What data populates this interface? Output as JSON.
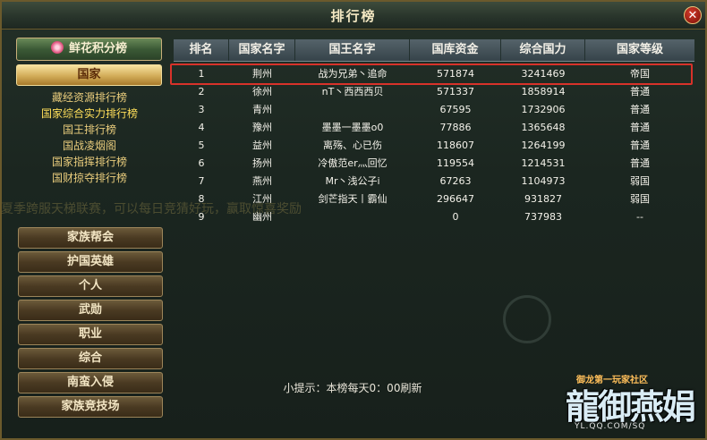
{
  "window": {
    "title": "排行榜",
    "close_glyph": "✕"
  },
  "sidebar": {
    "flower_header": "鲜花积分榜",
    "nation_button": "国家",
    "sub_items": [
      {
        "label": "藏经资源排行榜",
        "active": false
      },
      {
        "label": "国家综合实力排行榜",
        "active": true
      },
      {
        "label": "国王排行榜",
        "active": false
      },
      {
        "label": "国战凌烟阁",
        "active": false
      },
      {
        "label": "国家指挥排行榜",
        "active": false
      },
      {
        "label": "国财掠夺排行榜",
        "active": false
      }
    ],
    "menu": [
      "家族帮会",
      "护国英雄",
      "个人",
      "武勋",
      "职业",
      "综合",
      "南蛮入侵",
      "家族竞技场"
    ]
  },
  "table": {
    "headers": [
      "排名",
      "国家名字",
      "国王名字",
      "国库资金",
      "综合国力",
      "国家等级"
    ],
    "rows": [
      [
        "1",
        "荆州",
        "战为兄弟丶追命",
        "571874",
        "3241469",
        "帝国"
      ],
      [
        "2",
        "徐州",
        "nT丶西西西贝",
        "571337",
        "1858914",
        "普通"
      ],
      [
        "3",
        "青州",
        "",
        "67595",
        "1732906",
        "普通"
      ],
      [
        "4",
        "豫州",
        "墨墨一墨墨o0",
        "77886",
        "1365648",
        "普通"
      ],
      [
        "5",
        "益州",
        "离殇、心已伤",
        "118607",
        "1264199",
        "普通"
      ],
      [
        "6",
        "扬州",
        "冷傲范er灬回忆",
        "119554",
        "1214531",
        "普通"
      ],
      [
        "7",
        "燕州",
        "Mr丶浅公子i",
        "67263",
        "1104973",
        "弱国"
      ],
      [
        "8",
        "江州",
        "剑芒指天丨霸仙",
        "296647",
        "931827",
        "弱国"
      ],
      [
        "9",
        "幽州",
        "",
        "0",
        "737983",
        "--"
      ]
    ]
  },
  "tip": "小提示：本榜每天0：00刷新",
  "watermark": "夏季跨服天梯联赛，可以每日竞猜好玩，赢取惊喜奖励",
  "logo": {
    "top": "御龙第一玩家社区",
    "main": "龍御燕娟",
    "bottom": "YL.QQ.COM/SQ"
  },
  "colors": {
    "accent_gold": "#e9cc7c",
    "highlight_red": "#d8322a",
    "active_gold": "#ffdf5a"
  }
}
